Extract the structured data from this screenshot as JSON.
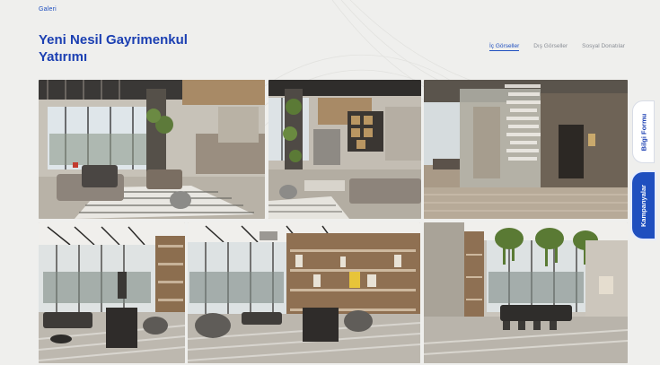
{
  "header": {
    "eyebrow": "Galeri",
    "title": "Yeni Nesil Gayrimenkul Yatırımı"
  },
  "tabs": [
    {
      "label": "İç Görseller",
      "active": true
    },
    {
      "label": "Dış Görseller",
      "active": false
    },
    {
      "label": "Sosyal Donatılar",
      "active": false
    }
  ],
  "side_buttons": {
    "info_form": "Bilgi Formu",
    "campaigns": "Kampanyalar"
  },
  "colors": {
    "brand_blue": "#1f4fbf",
    "background": "#efefed"
  }
}
